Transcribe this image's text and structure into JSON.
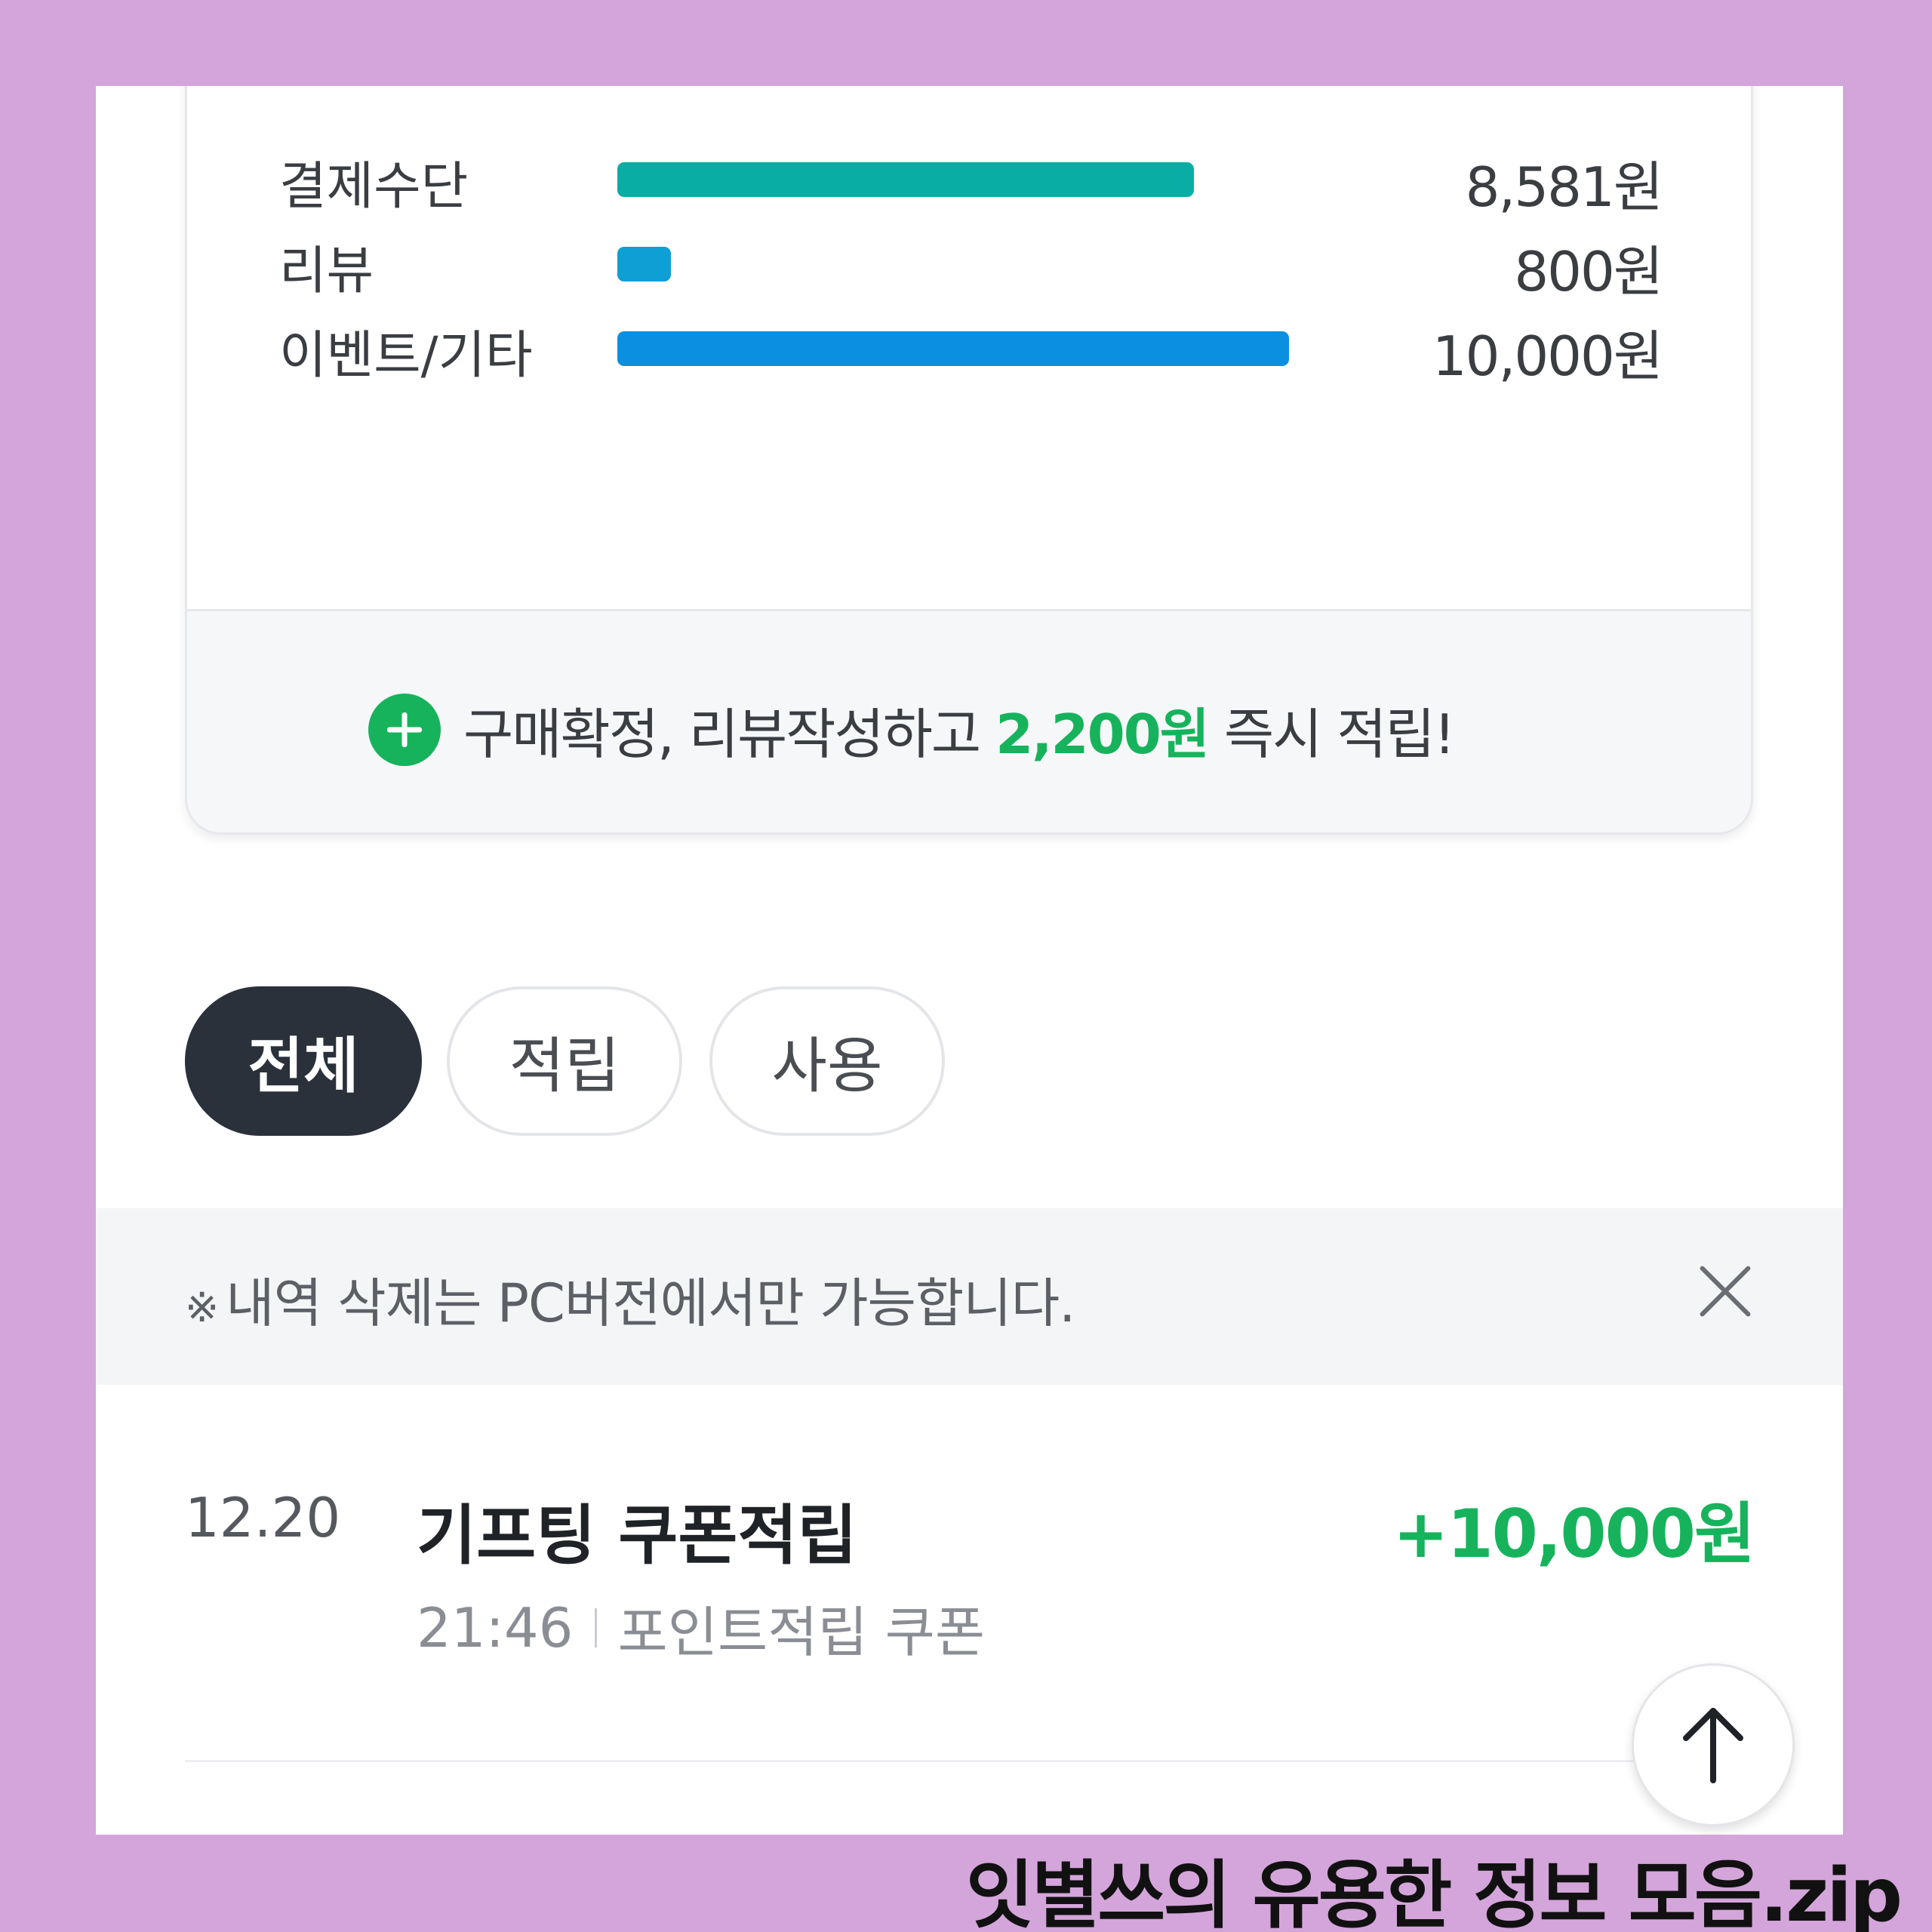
{
  "breakdown": {
    "rows": [
      {
        "label": "결제수단",
        "amount": "8,581원",
        "bar_ratio": 0.858,
        "bar_color": "#0aada3"
      },
      {
        "label": "리뷰",
        "amount": "800원",
        "bar_ratio": 0.08,
        "bar_color": "#0e9fd4"
      },
      {
        "label": "이벤트/기타",
        "amount": "10,000원",
        "bar_ratio": 1.0,
        "bar_color": "#0b8fe0"
      }
    ],
    "promo": {
      "before": "구매확정, 리뷰작성하고 ",
      "highlight": "2,200원",
      "after": " 즉시 적립!"
    }
  },
  "filters": {
    "all": "전체",
    "earn": "적립",
    "use": "사용",
    "selected": "전체"
  },
  "notice": {
    "mark": "※",
    "text": "내역 삭제는 PC버전에서만 가능합니다."
  },
  "history": [
    {
      "date": "12.20",
      "title": "기프팅 쿠폰적립",
      "amount": "+10,000원",
      "time": "21:46",
      "category": "포인트적립 쿠폰"
    }
  ],
  "watermark": "잇별쓰의 유용한 정보 모음.zip",
  "colors": {
    "accent_green": "#17b35c",
    "chip_active": "#2a313b",
    "page_background": "#d4a5da"
  },
  "icons": [
    "plus-circle-icon",
    "close-icon",
    "arrow-up-icon"
  ]
}
